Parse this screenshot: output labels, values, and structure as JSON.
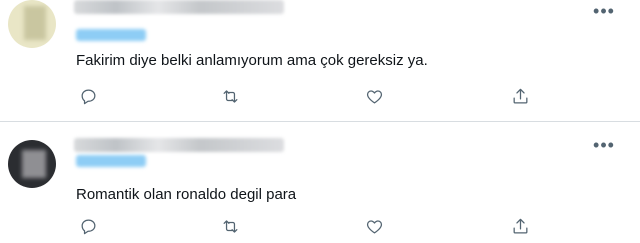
{
  "tweets": [
    {
      "text": "Fakirim diye belki anlamıyorum ama çok gereksiz ya.",
      "more_label": "•••"
    },
    {
      "text": "Romantik olan ronaldo degil para",
      "more_label": "•••"
    }
  ],
  "icons": {
    "reply": "reply-icon",
    "retweet": "retweet-icon",
    "like": "like-icon",
    "share": "share-icon"
  },
  "colors": {
    "icon": "#536471",
    "text": "#0f1419",
    "mention": "#1d9bf0"
  }
}
